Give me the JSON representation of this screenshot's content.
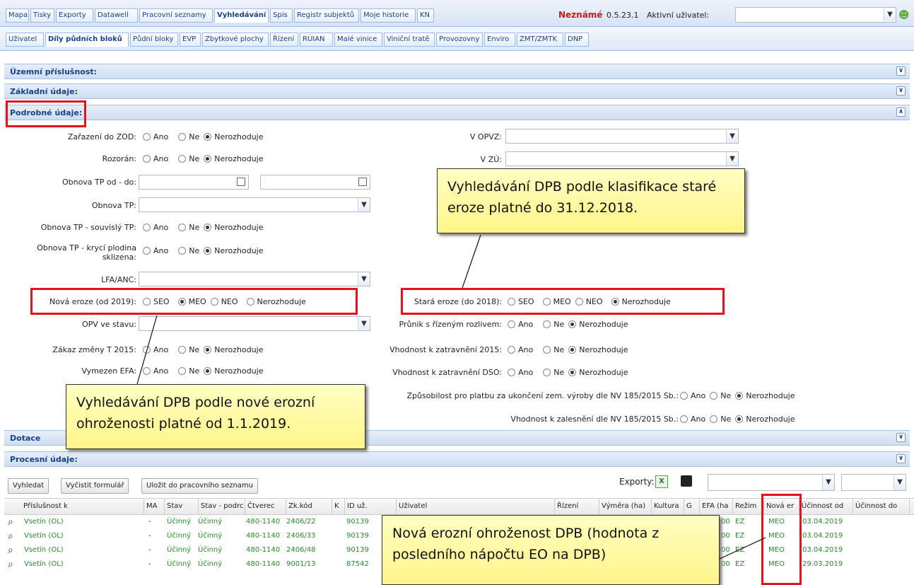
{
  "top_tabs": [
    "Mapa",
    "Tisky",
    "Exporty",
    "Datawell",
    "Pracovní seznamy",
    "Vyhledávání",
    "Spis",
    "Registr subjektů",
    "Moje historie",
    "KN"
  ],
  "status": {
    "unknown": "Neznámé",
    "version": "0.5.23.1",
    "user_label": "Aktivní uživatel:"
  },
  "sub_tabs": [
    "Uživatel",
    "Díly půdních bloků",
    "Půdní bloky",
    "EVP",
    "Zbytkové plochy",
    "Řízení",
    "RÚIAN",
    "Malé vinice",
    "Viniční tratě",
    "Provozovny",
    "Enviro",
    "ZMT/ZMTK",
    "DNP"
  ],
  "sections": {
    "territorial": "Územní příslušnost:",
    "basic": "Základní údaje:",
    "detailed": "Podrobné údaje:",
    "subsidies": "Dotace",
    "process": "Procesní údaje:"
  },
  "radio_options": {
    "ano": "Ano",
    "ne": "Ne",
    "nerozhoduje": "Nerozhoduje",
    "seo": "SEO",
    "meo": "MEO",
    "neo": "NEO"
  },
  "labels": {
    "zod": "Zařazení do ZOD:",
    "rozoran": "Rozorán:",
    "obnova_od_do": "Obnova TP od - do:",
    "obnova_tp": "Obnova TP:",
    "obnova_souvisly": "Obnova TP - souvislý TP:",
    "obnova_kryci1": "Obnova TP - krycí plodina",
    "obnova_kryci2": "sklizena:",
    "lfa": "LFA/ANC:",
    "nova_eroze": "Nová eroze (od 2019):",
    "opv": "OPV ve stavu:",
    "zakaz": "Zákaz změny T 2015:",
    "efa": "Vymezen EFA:",
    "opvz": "V OPVZ:",
    "zu": "V ZÚ:",
    "stara_eroze": "Stará eroze (do 2018):",
    "prunik": "Průnik s řízeným rozlivem:",
    "vhodnost2015": "Vhodnost k zatravnění 2015:",
    "vhodnost_dso": "Vhodnost k zatravnění DSO:",
    "zpusobilost": "Způsobilost pro platbu za ukončení zem. výroby dle NV 185/2015 Sb.:",
    "zalesneni": "Vhodnost k zalesnění dle NV 185/2015 Sb.:"
  },
  "notes": {
    "stara": "Vyhledávání DPB podle klasifikace staré eroze platné do 31.12.2018.",
    "nova": "Vyhledávání DPB podle nové erozní ohroženosti platné od 1.1.2019.",
    "vysledek": "Nová erozní ohroženost DPB (hodnota z posledního nápočtu EO na DPB)"
  },
  "buttons": {
    "search": "Vyhledat",
    "clear": "Vyčistit formulář",
    "save": "Uložit do pracovního seznamu",
    "exports": "Exporty:"
  },
  "columns": [
    "Příslušnost k",
    "MA",
    "Stav",
    "Stav - podrc",
    "Čtverec",
    "Zk.kód",
    "K",
    "ID už.",
    "Uživatel",
    "Řízení",
    "Výměra (ha)",
    "Kultura",
    "G",
    "EFA (ha",
    "Režim",
    "Nová er",
    "Účinnost od",
    "Účinnost do"
  ],
  "rows": [
    {
      "prislusnost": "Vsetín (OL)",
      "ma": "-",
      "stav": "Účinný",
      "stav2": "Účinný",
      "ctverec": "480-1140",
      "zk": "2406/22",
      "id": "90139",
      "efa": "00",
      "rezim": "EZ",
      "nova": "MEO",
      "od": "03.04.2019"
    },
    {
      "prislusnost": "Vsetín (OL)",
      "ma": "-",
      "stav": "Účinný",
      "stav2": "Účinný",
      "ctverec": "480-1140",
      "zk": "2406/33",
      "id": "90139",
      "efa": "00",
      "rezim": "EZ",
      "nova": "MEO",
      "od": "03.04.2019"
    },
    {
      "prislusnost": "Vsetín (OL)",
      "ma": "-",
      "stav": "Účinný",
      "stav2": "Účinný",
      "ctverec": "480-1140",
      "zk": "2406/48",
      "id": "90139",
      "efa": "00",
      "rezim": "EZ",
      "nova": "MEO",
      "od": "03.04.2019"
    },
    {
      "prislusnost": "Vsetín (OL)",
      "ma": "-",
      "stav": "Účinný",
      "stav2": "Účinný",
      "ctverec": "480-1140",
      "zk": "9001/13",
      "id": "87542",
      "efa": "00",
      "rezim": "EZ",
      "nova": "MEO",
      "od": "29.03.2019"
    }
  ]
}
